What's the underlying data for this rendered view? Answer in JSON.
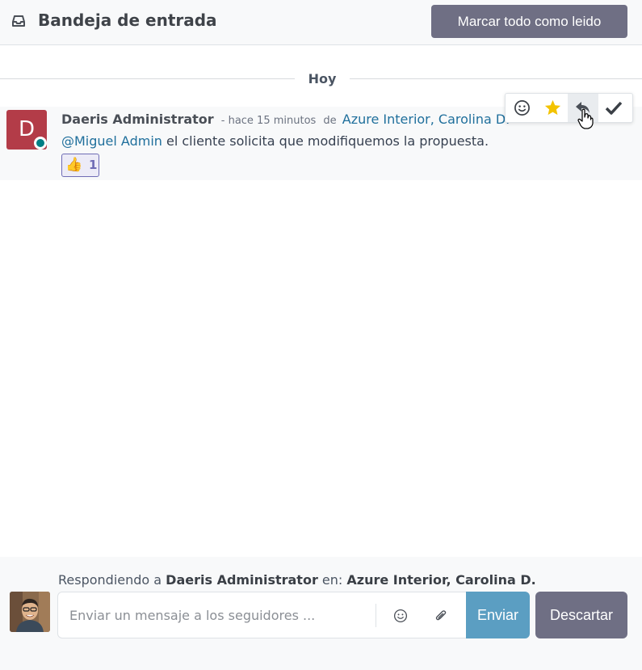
{
  "header": {
    "icon": "inbox-icon",
    "title": "Bandeja de entrada",
    "mark_all_label": "Marcar todo como leido"
  },
  "thread": {
    "day_label": "Hoy",
    "message": {
      "avatar_initial": "D",
      "avatar_color": "#b33c48",
      "presence_color": "#017e84",
      "author": "Daeris Administrator",
      "timestamp": "- hace 15 minutos",
      "from_label": "de",
      "record": "Azure Interior, Carolina D.",
      "mention": "@Miguel Admin",
      "body": " el cliente solicita que modifiquemos la propuesta.",
      "reaction": {
        "emoji": "👍",
        "count": "1"
      }
    },
    "actions": [
      {
        "icon": "smile-icon",
        "label": "Add a Reaction"
      },
      {
        "icon": "star-icon",
        "label": "Mark as Todo"
      },
      {
        "icon": "reply-icon",
        "label": "Reply"
      },
      {
        "icon": "check-icon",
        "label": "Mark as Read"
      }
    ]
  },
  "composer": {
    "reply_prefix": "Respondiendo a ",
    "reply_author": "Daeris Administrator",
    "reply_mid": " en: ",
    "reply_record": "Azure Interior, Carolina D.",
    "placeholder": "Enviar un mensaje a los seguidores ...",
    "send_label": "Enviar",
    "discard_label": "Descartar"
  },
  "colors": {
    "accent": "#6f6f84",
    "send": "#5b9ec2",
    "link": "#1f6f9c",
    "star": "#f3c300"
  }
}
